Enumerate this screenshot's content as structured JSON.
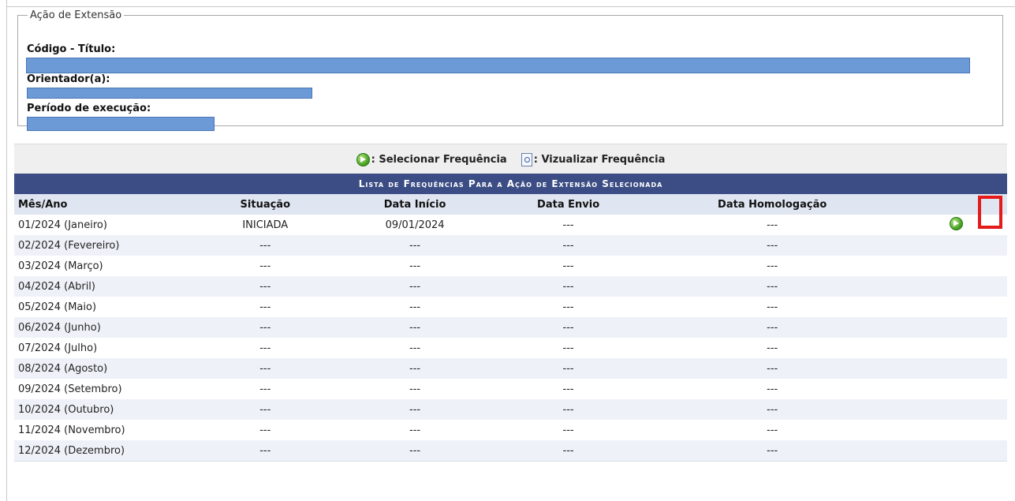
{
  "acao": {
    "legend": "Ação de Extensão",
    "codigo_titulo_label": "Código - Título:",
    "orientador_label": "Orientador(a):",
    "periodo_label": "Período de execução:"
  },
  "legend_bar": {
    "selecionar": ": Selecionar Frequência",
    "vizualizar": ": Vizualizar Frequência",
    "selecionar_icon": "green-arrow-icon",
    "vizualizar_icon": "document-magnifier-icon"
  },
  "table": {
    "caption": "Lista de Frequências Para a Ação de Extensão Selecionada",
    "headers": [
      "Mês/Ano",
      "Situação",
      "Data Início",
      "Data Envio",
      "Data Homologação"
    ],
    "rows": [
      {
        "mes": "01/2024 (Janeiro)",
        "situacao": "INICIADA",
        "inicio": "09/01/2024",
        "envio": "---",
        "homologacao": "---",
        "action": true
      },
      {
        "mes": "02/2024 (Fevereiro)",
        "situacao": "---",
        "inicio": "---",
        "envio": "---",
        "homologacao": "---",
        "action": false
      },
      {
        "mes": "03/2024 (Março)",
        "situacao": "---",
        "inicio": "---",
        "envio": "---",
        "homologacao": "---",
        "action": false
      },
      {
        "mes": "04/2024 (Abril)",
        "situacao": "---",
        "inicio": "---",
        "envio": "---",
        "homologacao": "---",
        "action": false
      },
      {
        "mes": "05/2024 (Maio)",
        "situacao": "---",
        "inicio": "---",
        "envio": "---",
        "homologacao": "---",
        "action": false
      },
      {
        "mes": "06/2024 (Junho)",
        "situacao": "---",
        "inicio": "---",
        "envio": "---",
        "homologacao": "---",
        "action": false
      },
      {
        "mes": "07/2024 (Julho)",
        "situacao": "---",
        "inicio": "---",
        "envio": "---",
        "homologacao": "---",
        "action": false
      },
      {
        "mes": "08/2024 (Agosto)",
        "situacao": "---",
        "inicio": "---",
        "envio": "---",
        "homologacao": "---",
        "action": false
      },
      {
        "mes": "09/2024 (Setembro)",
        "situacao": "---",
        "inicio": "---",
        "envio": "---",
        "homologacao": "---",
        "action": false
      },
      {
        "mes": "10/2024 (Outubro)",
        "situacao": "---",
        "inicio": "---",
        "envio": "---",
        "homologacao": "---",
        "action": false
      },
      {
        "mes": "11/2024 (Novembro)",
        "situacao": "---",
        "inicio": "---",
        "envio": "---",
        "homologacao": "---",
        "action": false
      },
      {
        "mes": "12/2024 (Dezembro)",
        "situacao": "---",
        "inicio": "---",
        "envio": "---",
        "homologacao": "---",
        "action": false
      }
    ]
  },
  "colors": {
    "caption_bg": "#3b4d84",
    "header_bg": "#dfe5f1",
    "row_alt_bg": "#eef2f8",
    "redaction": "#6b9ad6",
    "highlight": "#e31b1b"
  }
}
